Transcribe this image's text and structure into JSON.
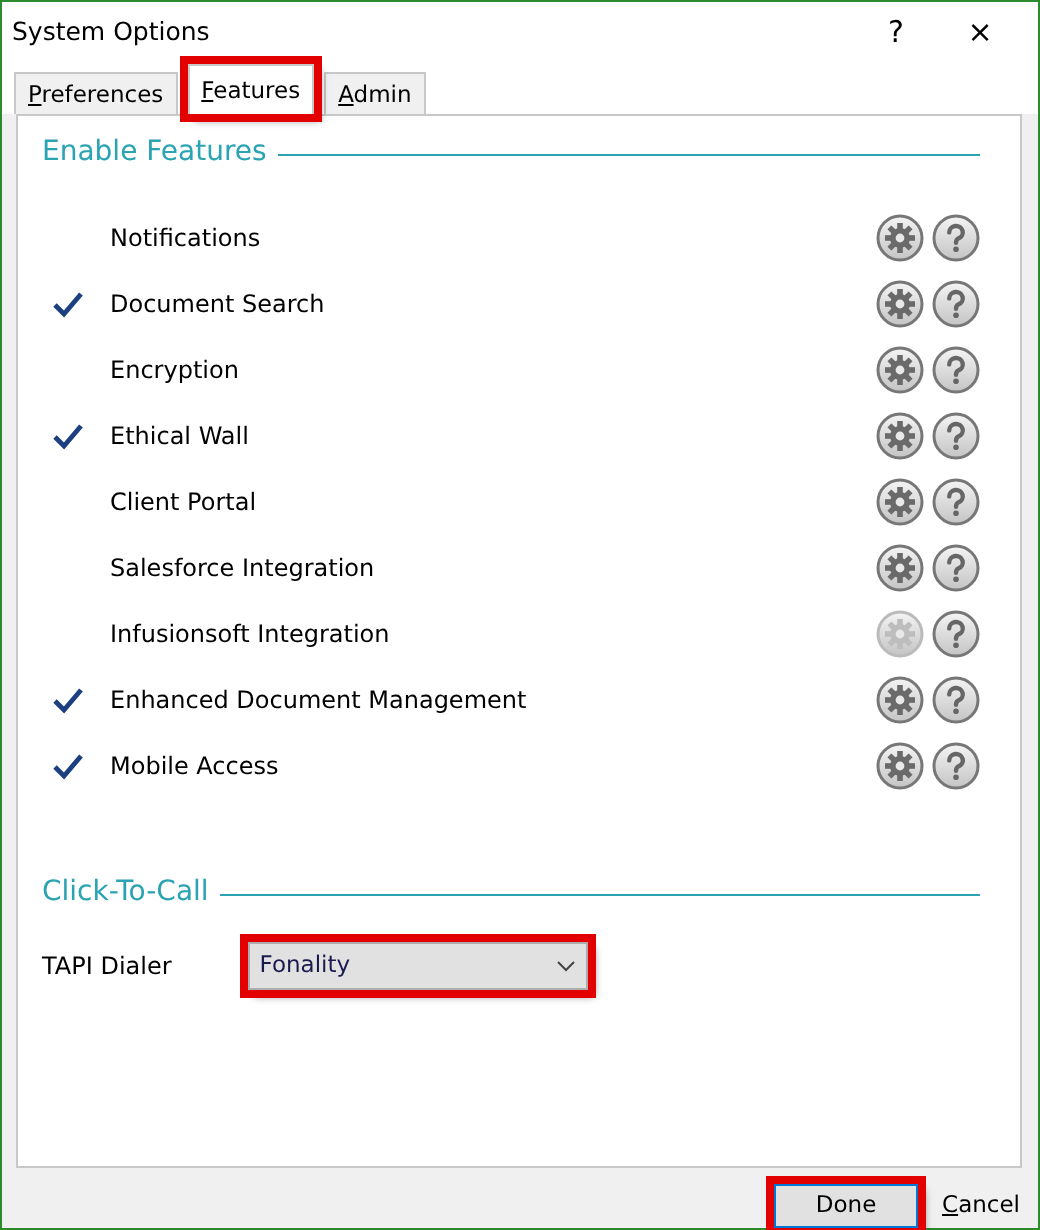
{
  "window": {
    "title": "System Options",
    "help_button": "?",
    "close_button": "×"
  },
  "tabs": [
    {
      "label": "Preferences",
      "selected": false,
      "mnemonic": true,
      "highlighted": false
    },
    {
      "label": "Features",
      "selected": true,
      "mnemonic": true,
      "highlighted": true
    },
    {
      "label": "Admin",
      "selected": false,
      "mnemonic": true,
      "highlighted": false
    }
  ],
  "enable_features": {
    "title": "Enable Features",
    "features": [
      {
        "label": "Notifications",
        "checked": false,
        "settings_disabled": false
      },
      {
        "label": "Document Search",
        "checked": true,
        "settings_disabled": false
      },
      {
        "label": "Encryption",
        "checked": false,
        "settings_disabled": false
      },
      {
        "label": "Ethical Wall",
        "checked": true,
        "settings_disabled": false
      },
      {
        "label": "Client Portal",
        "checked": false,
        "settings_disabled": false
      },
      {
        "label": "Salesforce Integration",
        "checked": false,
        "settings_disabled": false
      },
      {
        "label": "Infusionsoft Integration",
        "checked": false,
        "settings_disabled": true
      },
      {
        "label": "Enhanced Document Management",
        "checked": true,
        "settings_disabled": false
      },
      {
        "label": "Mobile Access",
        "checked": true,
        "settings_disabled": false
      }
    ]
  },
  "click_to_call": {
    "title": "Click-To-Call",
    "tapi_dialer": {
      "label": "TAPI Dialer",
      "value": "Fonality",
      "highlighted": true
    }
  },
  "buttons": [
    {
      "label": "Done",
      "kind": "default",
      "mnemonic": false,
      "highlighted": true
    },
    {
      "label": "Cancel",
      "kind": "link",
      "mnemonic": true,
      "highlighted": false
    }
  ]
}
